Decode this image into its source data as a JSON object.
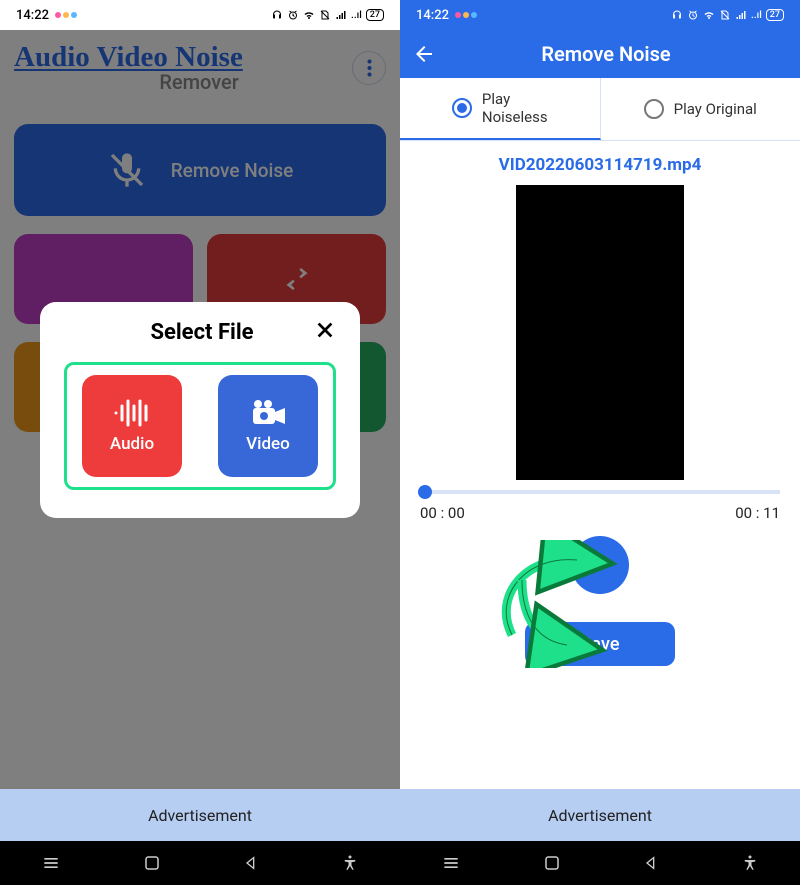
{
  "status": {
    "time": "14:22",
    "battery": "27"
  },
  "left": {
    "header": {
      "title": "Audio Video Noise",
      "subtitle": "Remover"
    },
    "main_button_label": "Remove Noise",
    "modal": {
      "title": "Select File",
      "audio_label": "Audio",
      "video_label": "Video"
    },
    "ad_label": "Advertisement"
  },
  "right": {
    "app_bar_title": "Remove Noise",
    "tab_noiseless_line1": "Play",
    "tab_noiseless_line2": "Noiseless",
    "tab_original": "Play Original",
    "filename": "VID20220603114719.mp4",
    "time_start": "00 : 00",
    "time_end": "00 : 11",
    "save_label": "Save",
    "ad_label": "Advertisement"
  }
}
